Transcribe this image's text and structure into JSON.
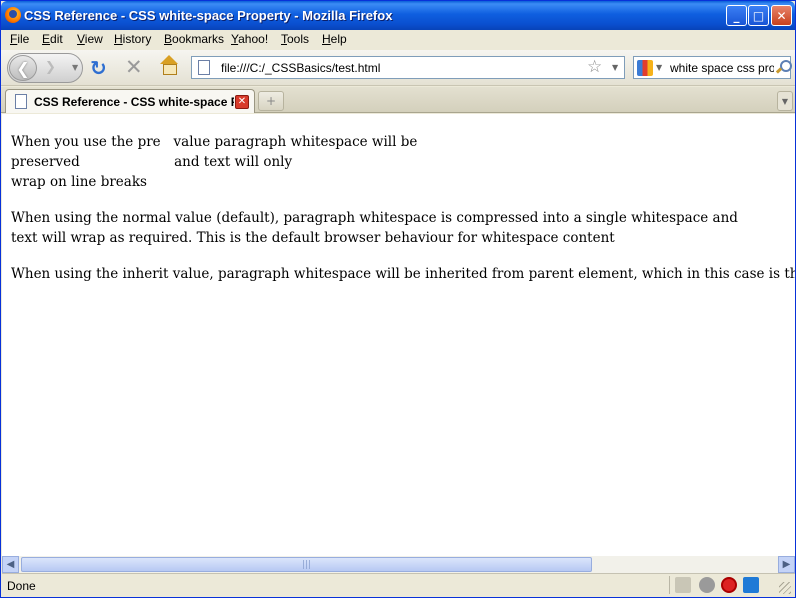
{
  "window": {
    "title": "CSS Reference - CSS white-space Property - Mozilla Firefox",
    "controls": {
      "minimize": "_",
      "maximize": "□",
      "close": "✕"
    }
  },
  "menubar": {
    "items": [
      "File",
      "Edit",
      "View",
      "History",
      "Bookmarks",
      "Yahoo!",
      "Tools",
      "Help"
    ]
  },
  "toolbar": {
    "back_glyph": "❮",
    "forward_glyph": "❯",
    "dropdown_glyph": "▼",
    "reload_glyph": "↻",
    "stop_glyph": "✕",
    "url": "file:///C:/_CSSBasics/test.html",
    "bookmark_glyph": "☆",
    "search_value": "white space css prop"
  },
  "tabs": {
    "active_label": "CSS Reference - CSS white-space Property",
    "close_glyph": "✕",
    "new_tab_glyph": "+",
    "list_glyph": "▼"
  },
  "content": {
    "pre_paragraph": "When you use the pre   value paragraph whitespace will be\npreserved                      and text will only\nwrap on line breaks",
    "normal_paragraph": "When using the normal value (default), paragraph whitespace is compressed into a single whitespace and text will wrap as required. This is the default browser behaviour for whitespace content",
    "inherit_paragraph": "When using the inherit value, paragraph whitespace will be inherited from parent element, which in this case is the body element which has the default whitespace value"
  },
  "scrollbar": {
    "left_glyph": "◀",
    "right_glyph": "▶",
    "grip_glyph": "|||"
  },
  "statusbar": {
    "text": "Done"
  },
  "colors": {
    "titlebar": "#0a4fcf",
    "content_bg": "#ffffff",
    "chrome_bg": "#ece9d8"
  },
  "icons": {
    "app": "firefox-icon",
    "home": "home-icon",
    "search_engine": "google-icon",
    "search": "magnifier-icon"
  }
}
